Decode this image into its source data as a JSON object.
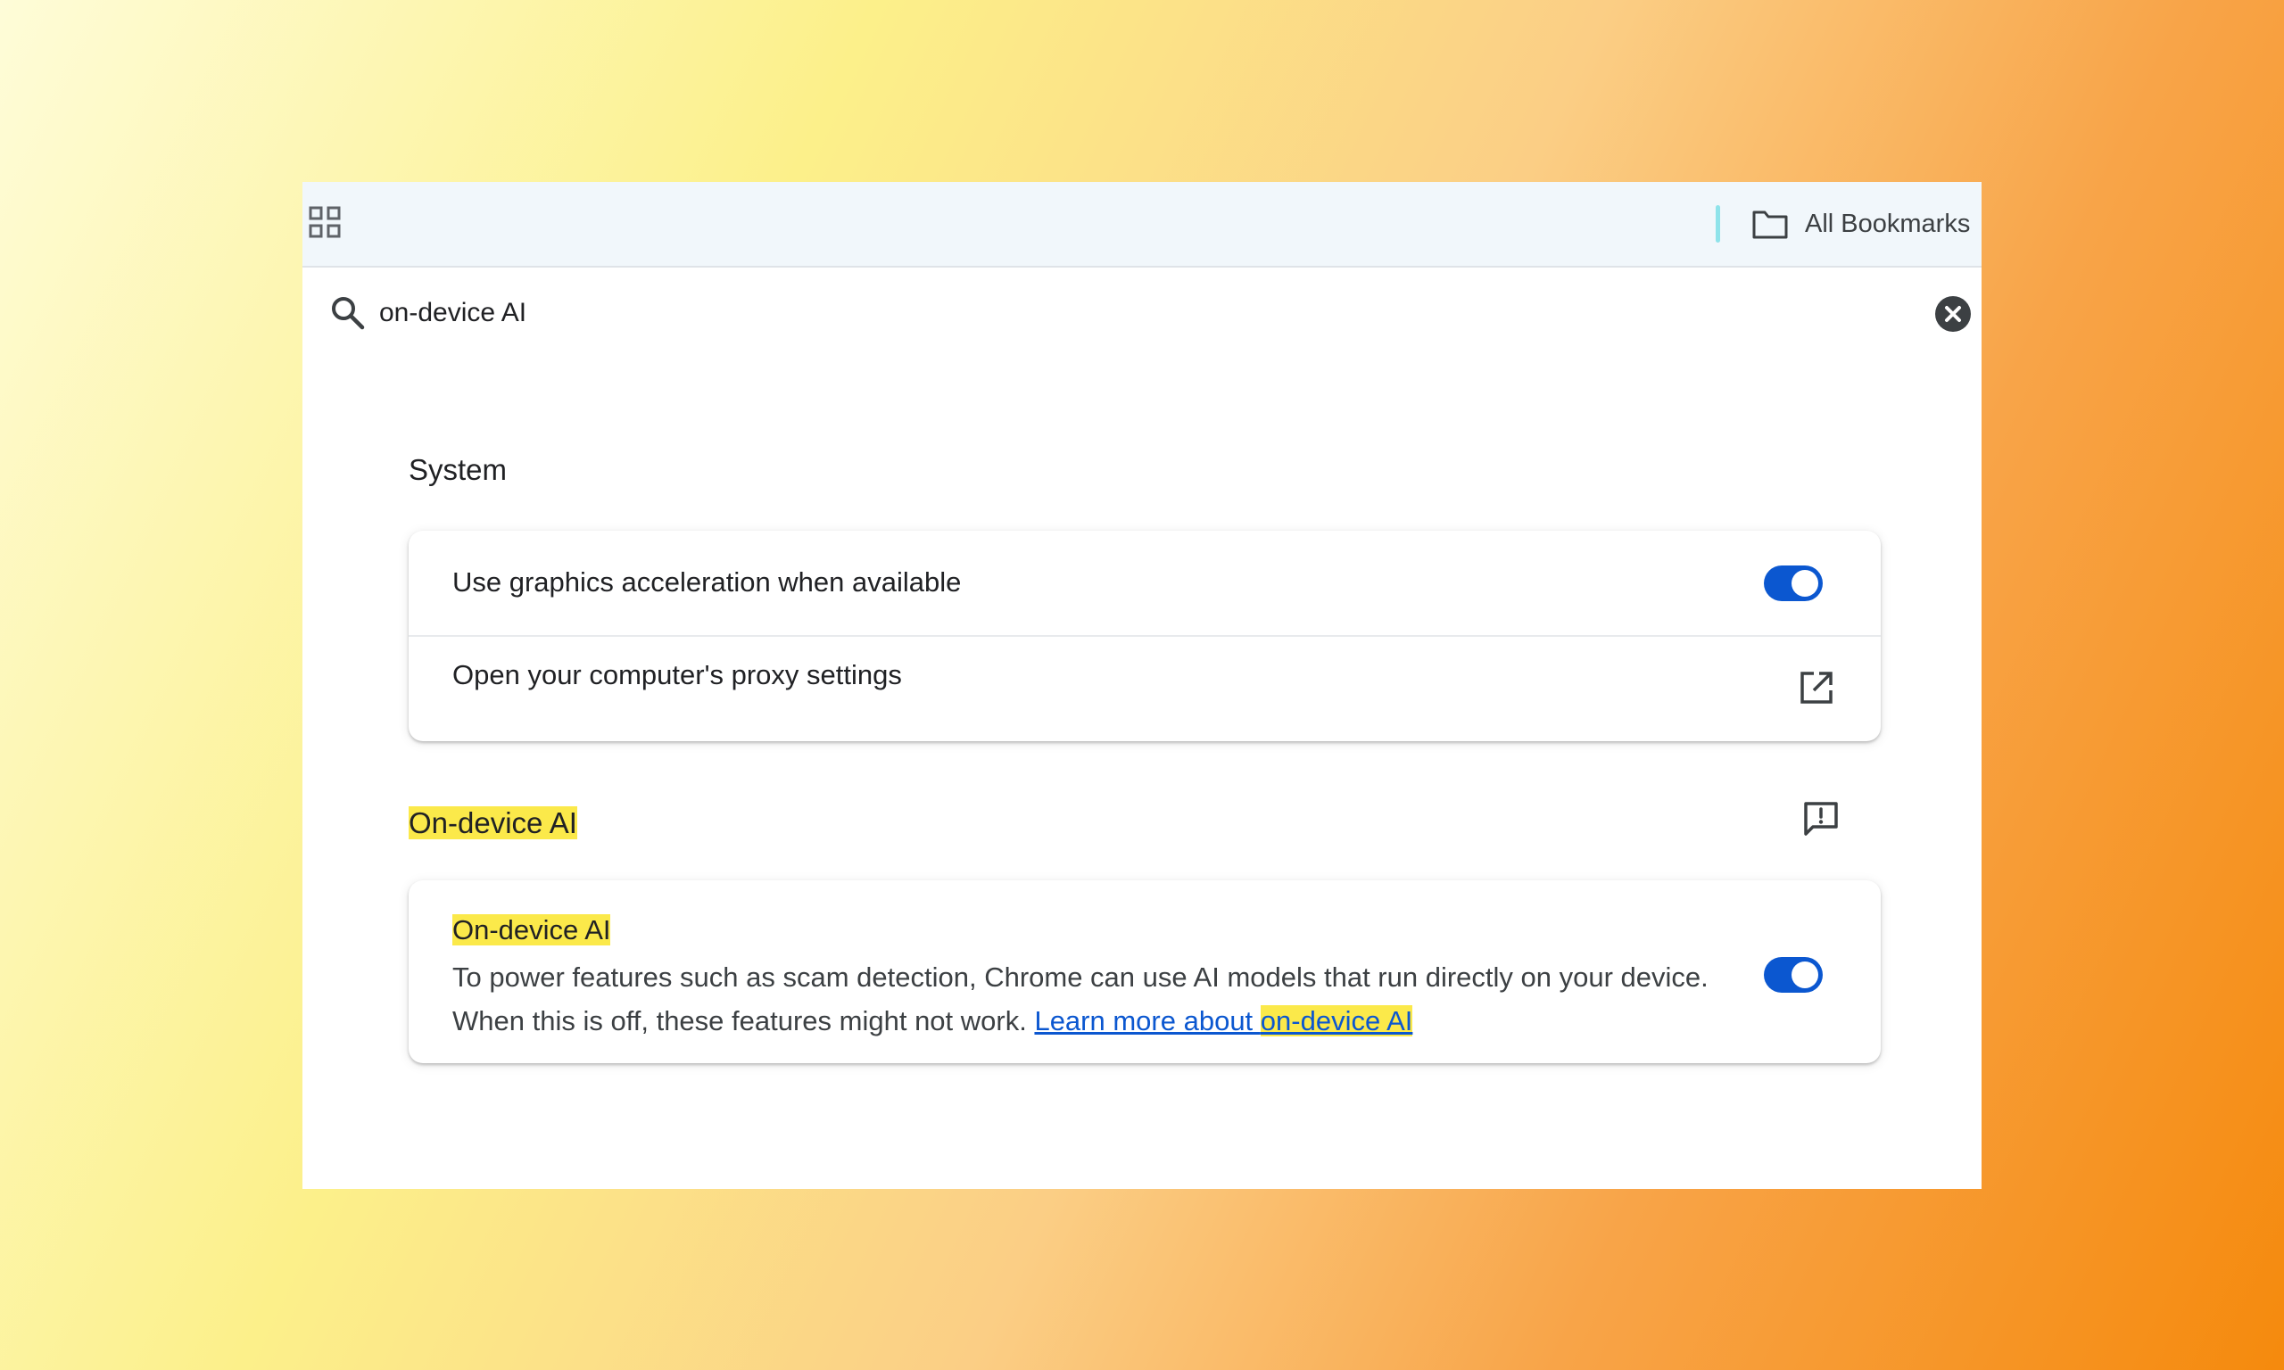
{
  "bookmarks_bar": {
    "apps_icon": "apps-grid-icon",
    "folder_icon": "folder-icon",
    "all_bookmarks_label": "All Bookmarks"
  },
  "search": {
    "icon": "search-icon",
    "query": "on-device AI",
    "clear_icon": "close-circle-icon"
  },
  "system_section": {
    "title": "System",
    "rows": [
      {
        "label": "Use graphics acceleration when available",
        "control": "toggle",
        "enabled": true
      },
      {
        "label": "Open your computer's proxy settings",
        "control": "external-link-icon"
      }
    ]
  },
  "ai_section": {
    "title": "On-device AI",
    "feedback_icon": "feedback-icon",
    "setting": {
      "title": "On-device AI",
      "description": "To power features such as scam detection, Chrome can use AI models that run directly on your device. When this is off, these features might not work. ",
      "link_prefix": "Learn more about ",
      "link_highlight": "on-device AI",
      "enabled": true
    }
  },
  "colors": {
    "accent": "#0b57d0",
    "highlight": "#fbe94a",
    "bar_background": "#f1f7fb",
    "divider_accent": "#8fe3ea"
  }
}
